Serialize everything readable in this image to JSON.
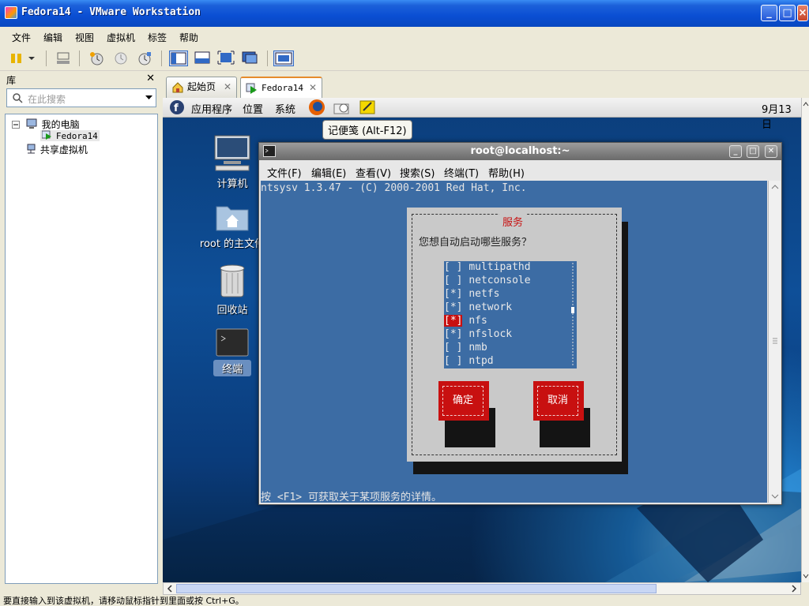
{
  "window": {
    "title": "Fedora14 - VMware Workstation"
  },
  "menubar": [
    "文件",
    "编辑",
    "视图",
    "虚拟机",
    "标签",
    "帮助"
  ],
  "library": {
    "title": "库",
    "search_placeholder": "在此搜索",
    "tree": {
      "root": "我的电脑",
      "vm": "Fedora14",
      "shared": "共享虚拟机"
    }
  },
  "tabs": [
    {
      "label": "起始页"
    },
    {
      "label": "Fedora14",
      "active": true
    }
  ],
  "guest": {
    "panel": {
      "apps": "应用程序",
      "places": "位置",
      "system": "系统",
      "clock": "9月13日"
    },
    "tooltip": "记便笺 (Alt-F12)",
    "desktop_icons": [
      "计算机",
      "root 的主文件",
      "回收站",
      "终端"
    ]
  },
  "terminal": {
    "title": "root@localhost:~",
    "menu": [
      "文件(F)",
      "编辑(E)",
      "查看(V)",
      "搜索(S)",
      "终端(T)",
      "帮助(H)"
    ],
    "header_line": "ntsysv 1.3.47 - (C) 2000-2001 Red Hat, Inc.",
    "footer_line": "按 <F1> 可获取关于某项服务的详情。",
    "dialog": {
      "title": "服务",
      "question": "您想自动启动哪些服务？",
      "services": [
        {
          "mark": "[ ]",
          "name": "multipathd"
        },
        {
          "mark": "[ ]",
          "name": "netconsole"
        },
        {
          "mark": "[*]",
          "name": "netfs"
        },
        {
          "mark": "[*]",
          "name": "network"
        },
        {
          "mark": "[*]",
          "name": "nfs"
        },
        {
          "mark": "[*]",
          "name": "nfslock"
        },
        {
          "mark": "[ ]",
          "name": "nmb"
        },
        {
          "mark": "[ ]",
          "name": "ntpd"
        }
      ],
      "ok": "确定",
      "cancel": "取消"
    }
  },
  "statusbar": "要直接输入到该虚拟机，请移动鼠标指针到里面或按 Ctrl+G。",
  "colors": {
    "xp_blue": "#0A4ED3",
    "terminal_bg": "#3C6CA4",
    "dialog_red": "#C81010"
  }
}
